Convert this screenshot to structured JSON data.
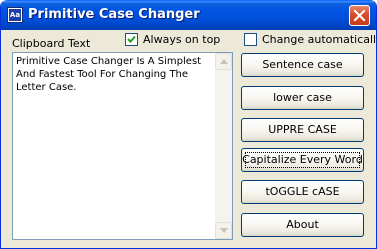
{
  "window": {
    "title": "Primitive Case Changer",
    "app_icon_text": "Aa"
  },
  "options": {
    "clipboard_label": "Clipboard Text",
    "always_on_top": {
      "label": "Always on top",
      "checked": true
    },
    "change_automatically": {
      "label": "Change automatically",
      "checked": false
    }
  },
  "textarea": {
    "value": "Primitive Case Changer Is A Simplest And Fastest Tool For Changing The Letter Case."
  },
  "buttons": {
    "sentence_case": "Sentence case",
    "lower_case": "lower case",
    "upper_case": "UPPRE CASE",
    "capitalize": "Capitalize Every Word",
    "toggle_case": "tOGGLE cASE",
    "about": "About"
  },
  "colors": {
    "titlebar": "#0054e3",
    "window_bg": "#ece9d8",
    "close_button": "#d8512f",
    "button_border": "#003c74"
  }
}
